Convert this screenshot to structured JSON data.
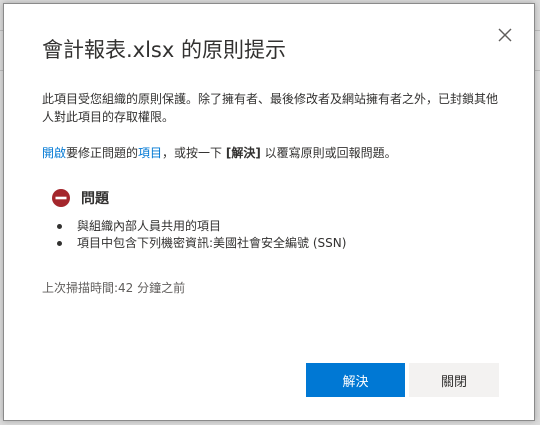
{
  "dialog": {
    "title": "會計報表.xlsx 的原則提示",
    "close_icon": "close-icon",
    "description": "此項目受您組織的原則保護。除了擁有者、最後修改者及網站擁有者之外，已封鎖其他人對此項目的存取權限。",
    "action": {
      "link_open": "開啟",
      "text_1": "要修正問題的",
      "link_item": "項目",
      "text_2": "，或按一下 ",
      "bold_resolve": "[解決]",
      "text_3": " 以覆寫原則或回報問題。"
    },
    "issues": {
      "icon": "blocked-icon",
      "title": "問題",
      "items": [
        "與組織內部人員共用的項目",
        "項目中包含下列機密資訊:美國社會安全編號 (SSN)"
      ]
    },
    "scan_time": "上次掃描時間:42 分鐘之前",
    "buttons": {
      "resolve": "解決",
      "close": "關閉"
    }
  },
  "colors": {
    "accent": "#0078d4",
    "blocked": "#a4262c",
    "text": "#323130",
    "muted": "#605e5c"
  }
}
